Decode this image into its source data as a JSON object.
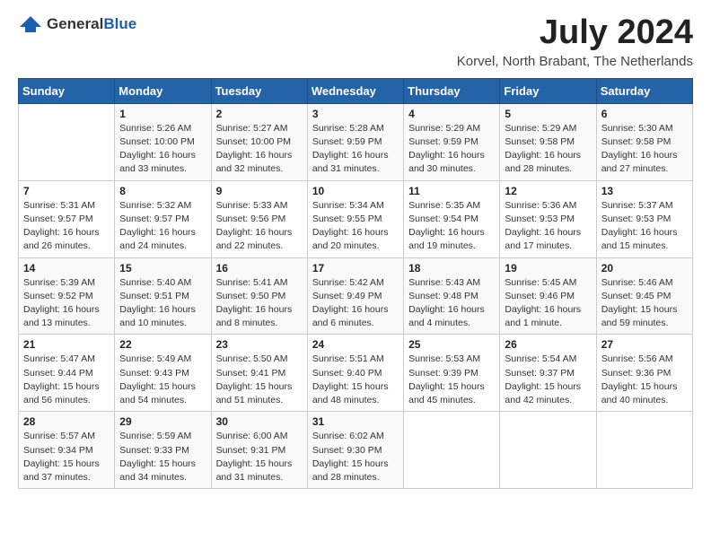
{
  "logo": {
    "general": "General",
    "blue": "Blue"
  },
  "title": "July 2024",
  "location": "Korvel, North Brabant, The Netherlands",
  "days_header": [
    "Sunday",
    "Monday",
    "Tuesday",
    "Wednesday",
    "Thursday",
    "Friday",
    "Saturday"
  ],
  "weeks": [
    [
      {
        "num": "",
        "info": ""
      },
      {
        "num": "1",
        "info": "Sunrise: 5:26 AM\nSunset: 10:00 PM\nDaylight: 16 hours\nand 33 minutes."
      },
      {
        "num": "2",
        "info": "Sunrise: 5:27 AM\nSunset: 10:00 PM\nDaylight: 16 hours\nand 32 minutes."
      },
      {
        "num": "3",
        "info": "Sunrise: 5:28 AM\nSunset: 9:59 PM\nDaylight: 16 hours\nand 31 minutes."
      },
      {
        "num": "4",
        "info": "Sunrise: 5:29 AM\nSunset: 9:59 PM\nDaylight: 16 hours\nand 30 minutes."
      },
      {
        "num": "5",
        "info": "Sunrise: 5:29 AM\nSunset: 9:58 PM\nDaylight: 16 hours\nand 28 minutes."
      },
      {
        "num": "6",
        "info": "Sunrise: 5:30 AM\nSunset: 9:58 PM\nDaylight: 16 hours\nand 27 minutes."
      }
    ],
    [
      {
        "num": "7",
        "info": "Sunrise: 5:31 AM\nSunset: 9:57 PM\nDaylight: 16 hours\nand 26 minutes."
      },
      {
        "num": "8",
        "info": "Sunrise: 5:32 AM\nSunset: 9:57 PM\nDaylight: 16 hours\nand 24 minutes."
      },
      {
        "num": "9",
        "info": "Sunrise: 5:33 AM\nSunset: 9:56 PM\nDaylight: 16 hours\nand 22 minutes."
      },
      {
        "num": "10",
        "info": "Sunrise: 5:34 AM\nSunset: 9:55 PM\nDaylight: 16 hours\nand 20 minutes."
      },
      {
        "num": "11",
        "info": "Sunrise: 5:35 AM\nSunset: 9:54 PM\nDaylight: 16 hours\nand 19 minutes."
      },
      {
        "num": "12",
        "info": "Sunrise: 5:36 AM\nSunset: 9:53 PM\nDaylight: 16 hours\nand 17 minutes."
      },
      {
        "num": "13",
        "info": "Sunrise: 5:37 AM\nSunset: 9:53 PM\nDaylight: 16 hours\nand 15 minutes."
      }
    ],
    [
      {
        "num": "14",
        "info": "Sunrise: 5:39 AM\nSunset: 9:52 PM\nDaylight: 16 hours\nand 13 minutes."
      },
      {
        "num": "15",
        "info": "Sunrise: 5:40 AM\nSunset: 9:51 PM\nDaylight: 16 hours\nand 10 minutes."
      },
      {
        "num": "16",
        "info": "Sunrise: 5:41 AM\nSunset: 9:50 PM\nDaylight: 16 hours\nand 8 minutes."
      },
      {
        "num": "17",
        "info": "Sunrise: 5:42 AM\nSunset: 9:49 PM\nDaylight: 16 hours\nand 6 minutes."
      },
      {
        "num": "18",
        "info": "Sunrise: 5:43 AM\nSunset: 9:48 PM\nDaylight: 16 hours\nand 4 minutes."
      },
      {
        "num": "19",
        "info": "Sunrise: 5:45 AM\nSunset: 9:46 PM\nDaylight: 16 hours\nand 1 minute."
      },
      {
        "num": "20",
        "info": "Sunrise: 5:46 AM\nSunset: 9:45 PM\nDaylight: 15 hours\nand 59 minutes."
      }
    ],
    [
      {
        "num": "21",
        "info": "Sunrise: 5:47 AM\nSunset: 9:44 PM\nDaylight: 15 hours\nand 56 minutes."
      },
      {
        "num": "22",
        "info": "Sunrise: 5:49 AM\nSunset: 9:43 PM\nDaylight: 15 hours\nand 54 minutes."
      },
      {
        "num": "23",
        "info": "Sunrise: 5:50 AM\nSunset: 9:41 PM\nDaylight: 15 hours\nand 51 minutes."
      },
      {
        "num": "24",
        "info": "Sunrise: 5:51 AM\nSunset: 9:40 PM\nDaylight: 15 hours\nand 48 minutes."
      },
      {
        "num": "25",
        "info": "Sunrise: 5:53 AM\nSunset: 9:39 PM\nDaylight: 15 hours\nand 45 minutes."
      },
      {
        "num": "26",
        "info": "Sunrise: 5:54 AM\nSunset: 9:37 PM\nDaylight: 15 hours\nand 42 minutes."
      },
      {
        "num": "27",
        "info": "Sunrise: 5:56 AM\nSunset: 9:36 PM\nDaylight: 15 hours\nand 40 minutes."
      }
    ],
    [
      {
        "num": "28",
        "info": "Sunrise: 5:57 AM\nSunset: 9:34 PM\nDaylight: 15 hours\nand 37 minutes."
      },
      {
        "num": "29",
        "info": "Sunrise: 5:59 AM\nSunset: 9:33 PM\nDaylight: 15 hours\nand 34 minutes."
      },
      {
        "num": "30",
        "info": "Sunrise: 6:00 AM\nSunset: 9:31 PM\nDaylight: 15 hours\nand 31 minutes."
      },
      {
        "num": "31",
        "info": "Sunrise: 6:02 AM\nSunset: 9:30 PM\nDaylight: 15 hours\nand 28 minutes."
      },
      {
        "num": "",
        "info": ""
      },
      {
        "num": "",
        "info": ""
      },
      {
        "num": "",
        "info": ""
      }
    ]
  ]
}
